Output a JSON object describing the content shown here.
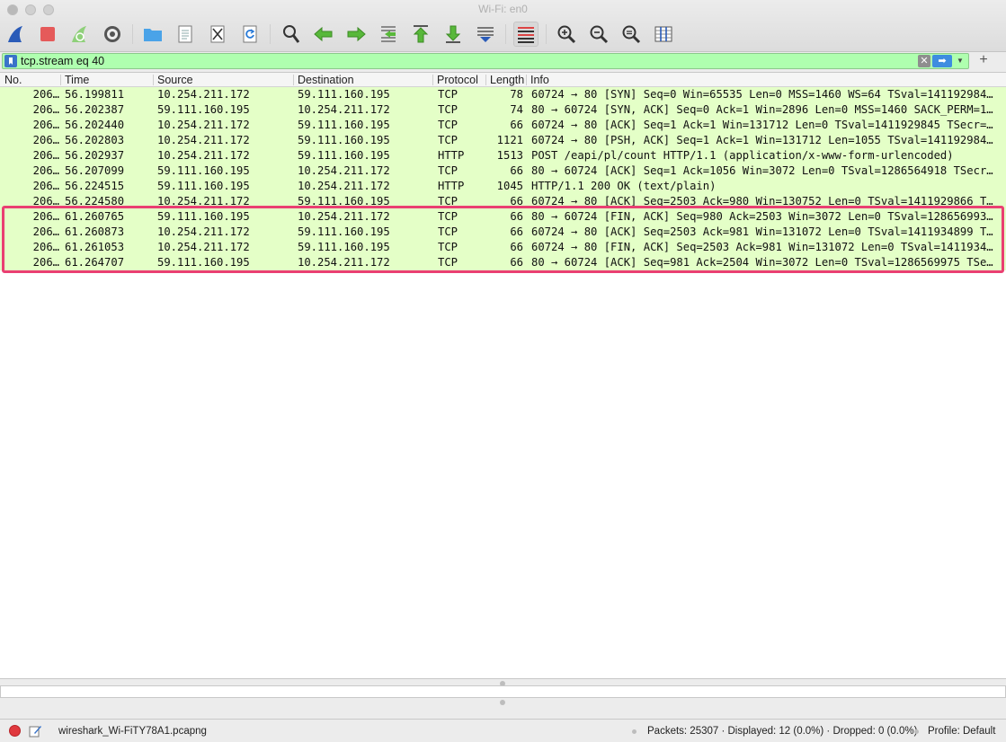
{
  "window": {
    "title": "Wi-Fi: en0"
  },
  "filter": {
    "value": "tcp.stream eq 40"
  },
  "columns": [
    "No.",
    "Time",
    "Source",
    "Destination",
    "Protocol",
    "Length",
    "Info"
  ],
  "packets": [
    {
      "no": "206…",
      "time": "56.199811",
      "src": "10.254.211.172",
      "dst": "59.111.160.195",
      "proto": "TCP",
      "len": "78",
      "info": "60724 → 80 [SYN] Seq=0 Win=65535 Len=0 MSS=1460 WS=64 TSval=141192984…"
    },
    {
      "no": "206…",
      "time": "56.202387",
      "src": "59.111.160.195",
      "dst": "10.254.211.172",
      "proto": "TCP",
      "len": "74",
      "info": "80 → 60724 [SYN, ACK] Seq=0 Ack=1 Win=2896 Len=0 MSS=1460 SACK_PERM=1…"
    },
    {
      "no": "206…",
      "time": "56.202440",
      "src": "10.254.211.172",
      "dst": "59.111.160.195",
      "proto": "TCP",
      "len": "66",
      "info": "60724 → 80 [ACK] Seq=1 Ack=1 Win=131712 Len=0 TSval=1411929845 TSecr=…"
    },
    {
      "no": "206…",
      "time": "56.202803",
      "src": "10.254.211.172",
      "dst": "59.111.160.195",
      "proto": "TCP",
      "len": "1121",
      "info": "60724 → 80 [PSH, ACK] Seq=1 Ack=1 Win=131712 Len=1055 TSval=141192984…"
    },
    {
      "no": "206…",
      "time": "56.202937",
      "src": "10.254.211.172",
      "dst": "59.111.160.195",
      "proto": "HTTP",
      "len": "1513",
      "info": "POST /eapi/pl/count HTTP/1.1  (application/x-www-form-urlencoded)"
    },
    {
      "no": "206…",
      "time": "56.207099",
      "src": "59.111.160.195",
      "dst": "10.254.211.172",
      "proto": "TCP",
      "len": "66",
      "info": "80 → 60724 [ACK] Seq=1 Ack=1056 Win=3072 Len=0 TSval=1286564918 TSecr…"
    },
    {
      "no": "206…",
      "time": "56.224515",
      "src": "59.111.160.195",
      "dst": "10.254.211.172",
      "proto": "HTTP",
      "len": "1045",
      "info": "HTTP/1.1 200 OK  (text/plain)"
    },
    {
      "no": "206…",
      "time": "56.224580",
      "src": "10.254.211.172",
      "dst": "59.111.160.195",
      "proto": "TCP",
      "len": "66",
      "info": "60724 → 80 [ACK] Seq=2503 Ack=980 Win=130752 Len=0 TSval=1411929866 T…"
    },
    {
      "no": "206…",
      "time": "61.260765",
      "src": "59.111.160.195",
      "dst": "10.254.211.172",
      "proto": "TCP",
      "len": "66",
      "info": "80 → 60724 [FIN, ACK] Seq=980 Ack=2503 Win=3072 Len=0 TSval=128656993…"
    },
    {
      "no": "206…",
      "time": "61.260873",
      "src": "10.254.211.172",
      "dst": "59.111.160.195",
      "proto": "TCP",
      "len": "66",
      "info": "60724 → 80 [ACK] Seq=2503 Ack=981 Win=131072 Len=0 TSval=1411934899 T…"
    },
    {
      "no": "206…",
      "time": "61.261053",
      "src": "10.254.211.172",
      "dst": "59.111.160.195",
      "proto": "TCP",
      "len": "66",
      "info": "60724 → 80 [FIN, ACK] Seq=2503 Ack=981 Win=131072 Len=0 TSval=1411934…"
    },
    {
      "no": "206…",
      "time": "61.264707",
      "src": "59.111.160.195",
      "dst": "10.254.211.172",
      "proto": "TCP",
      "len": "66",
      "info": "80 → 60724 [ACK] Seq=981 Ack=2504 Win=3072 Len=0 TSval=1286569975 TSe…"
    }
  ],
  "status": {
    "file": "wireshark_Wi-FiTY78A1.pcapng",
    "stats": "Packets: 25307 · Displayed: 12 (0.0%) · Dropped: 0 (0.0%)",
    "profile": "Profile: Default"
  },
  "colors": {
    "row_bg": "#e4ffc7",
    "filter_bg": "#afffaf",
    "highlight": "#ea3f72"
  }
}
